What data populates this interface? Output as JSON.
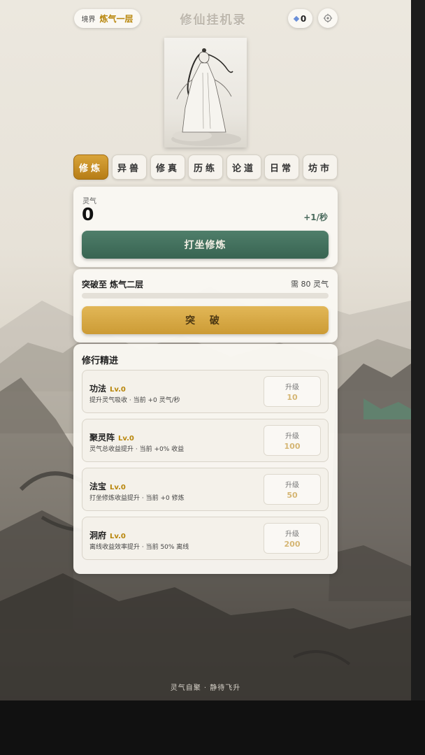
{
  "header": {
    "realm_key": "境界",
    "realm_value": "炼气一层",
    "title": "修仙挂机录",
    "gems": "0"
  },
  "tabs": [
    {
      "label": "修炼",
      "active": true
    },
    {
      "label": "异兽",
      "active": false
    },
    {
      "label": "修真",
      "active": false
    },
    {
      "label": "历练",
      "active": false
    },
    {
      "label": "论道",
      "active": false
    },
    {
      "label": "日常",
      "active": false
    },
    {
      "label": "坊市",
      "active": false
    }
  ],
  "qi": {
    "label": "灵气",
    "value": "0",
    "rate": "+1/秒",
    "button": "打坐修炼"
  },
  "breakthrough": {
    "title": "突破至 炼气二层",
    "need": "需 80 灵气",
    "progress": 0,
    "button": "突 破"
  },
  "upgrades": {
    "title": "修行精进",
    "items": [
      {
        "name": "功法",
        "level": "Lv.0",
        "desc": "提升灵气吸收 · 当前 +0 灵气/秒",
        "btn_label": "升级",
        "cost": "10"
      },
      {
        "name": "聚灵阵",
        "level": "Lv.0",
        "desc": "灵气总收益提升 · 当前 +0% 收益",
        "btn_label": "升级",
        "cost": "100"
      },
      {
        "name": "法宝",
        "level": "Lv.0",
        "desc": "打坐修炼收益提升 · 当前 +0 修炼",
        "btn_label": "升级",
        "cost": "50"
      },
      {
        "name": "洞府",
        "level": "Lv.0",
        "desc": "离线收益效率提升 · 当前 50% 离线",
        "btn_label": "升级",
        "cost": "200"
      }
    ]
  },
  "footer": "灵气自聚 · 静待飞升",
  "colors": {
    "accent_gold": "#b8860b",
    "cultivate_green": "#386452",
    "breakthrough_gold": "#cc9b35"
  }
}
